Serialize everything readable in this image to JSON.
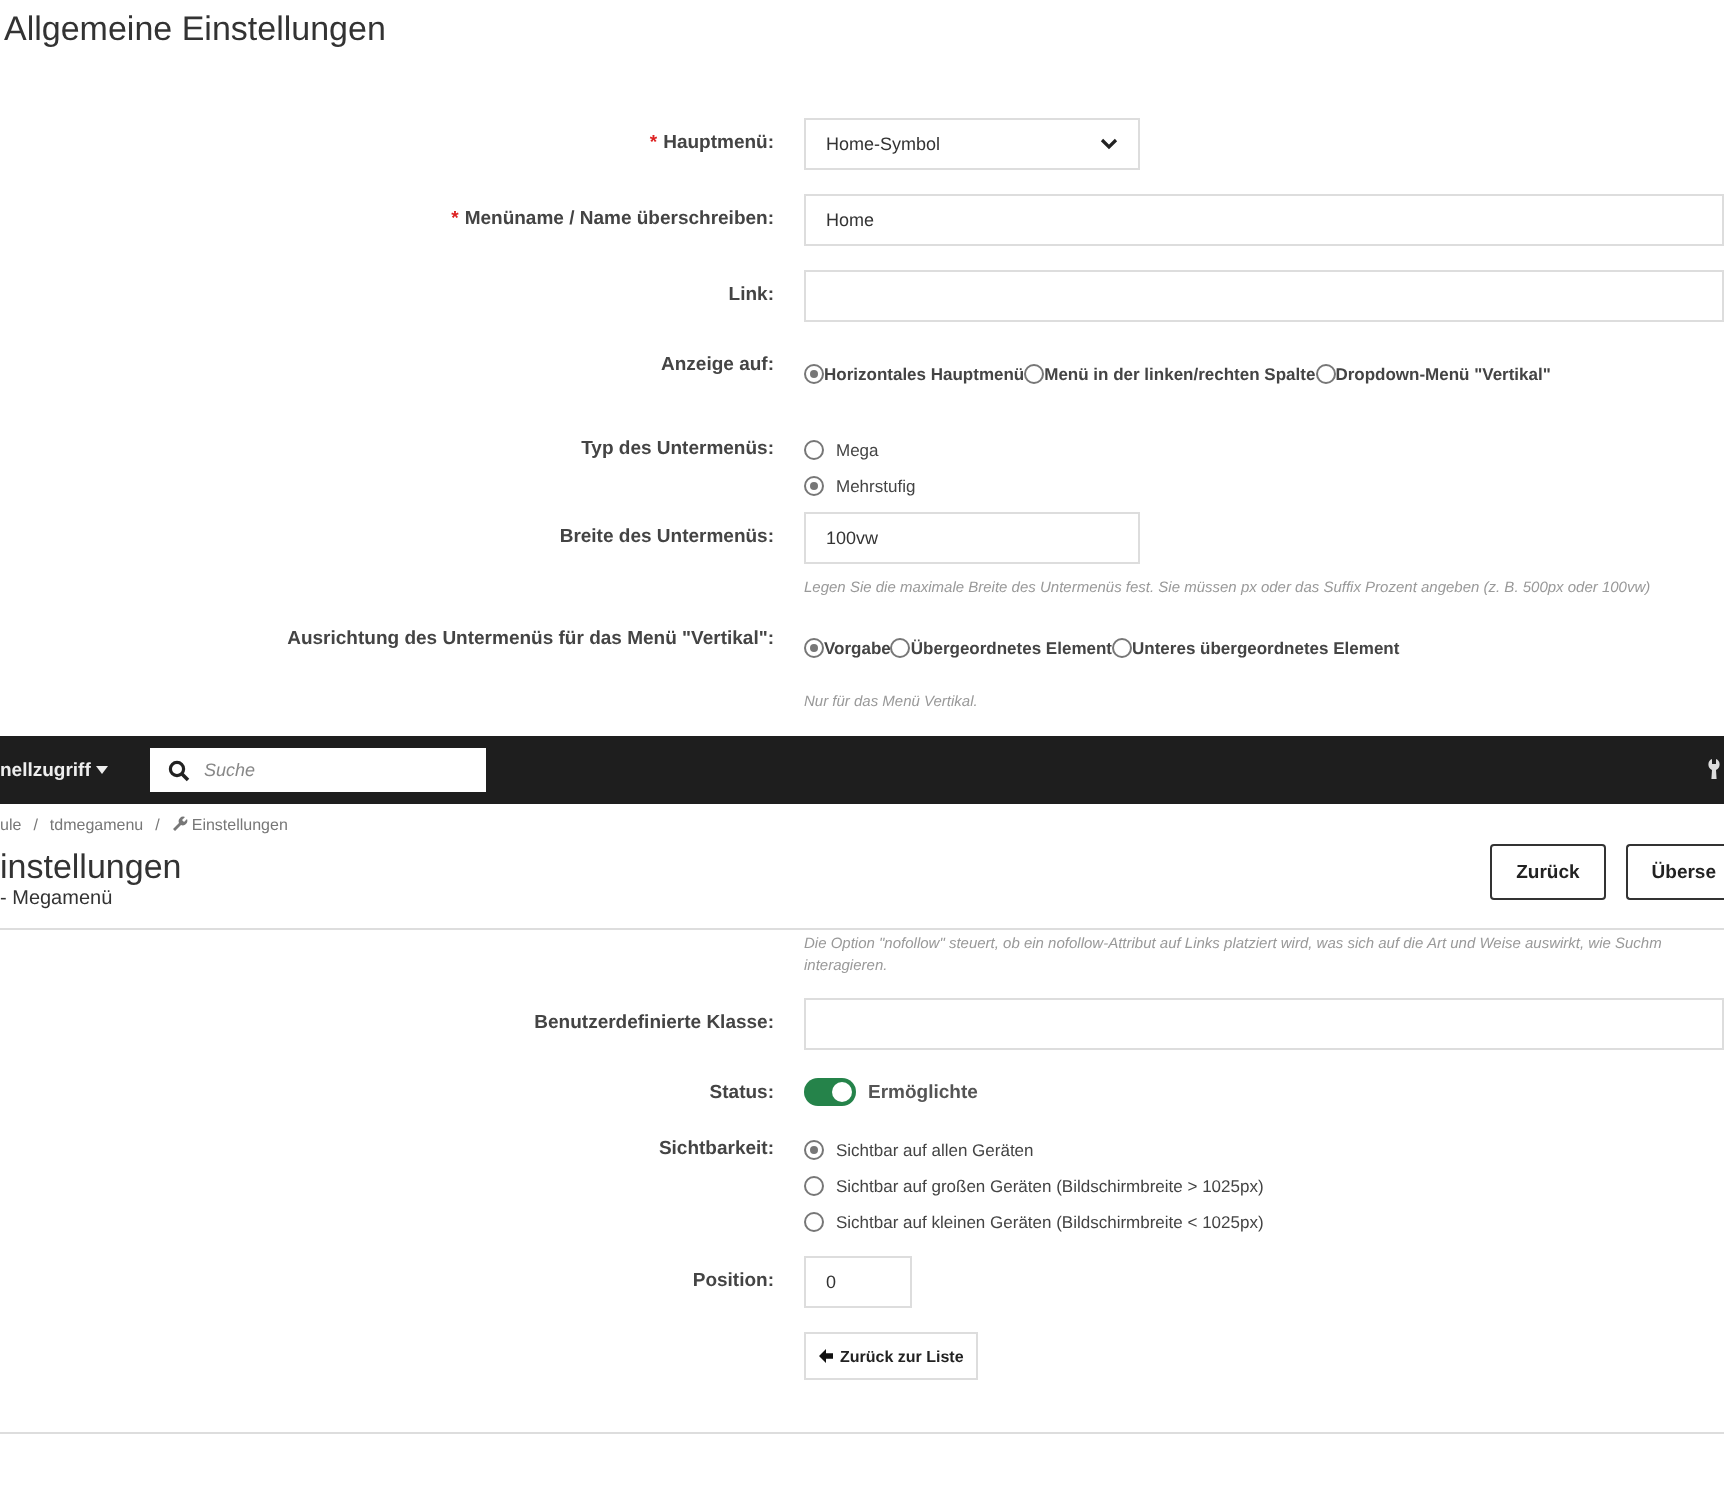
{
  "section_title": "Allgemeine Einstellungen",
  "general_fields": [
    {
      "kind": "select",
      "label": "Hauptmenü:",
      "required": "*",
      "value": "Home-Symbol"
    },
    {
      "kind": "text",
      "label": "Menüname / Name überschreiben:",
      "required": "*",
      "value": "Home",
      "wide": true
    },
    {
      "kind": "text",
      "label": "Link:",
      "wide": true
    },
    {
      "kind": "radio_row",
      "label": "Anzeige auf:",
      "options": [
        {
          "label": "Horizontales Hauptmenü",
          "selected": true
        },
        {
          "label": "Menü in der linken/rechten Spalte",
          "selected": false
        },
        {
          "label": "Dropdown-Menü \"Vertikal\"",
          "selected": false
        }
      ]
    },
    {
      "kind": "radio_list",
      "label": "Typ des Untermenüs:",
      "options": [
        {
          "label": "Mega",
          "selected": false
        },
        {
          "label": "Mehrstufig",
          "selected": true
        }
      ]
    },
    {
      "kind": "text",
      "label": "Breite des Untermenüs:",
      "value": "100vw",
      "wide": false,
      "help": "Legen Sie die maximale Breite des Untermenüs fest. Sie müssen px oder das Suffix Prozent angeben (z. B. 500px oder 100vw)"
    },
    {
      "kind": "radio_row",
      "label": "Ausrichtung des Untermenüs für das Menü \"Vertikal\":",
      "options": [
        {
          "label": "Vorgabe",
          "selected": true
        },
        {
          "label": "Übergeordnetes Element",
          "selected": false
        },
        {
          "label": "Unteres übergeordnetes Element",
          "selected": false
        }
      ],
      "help": "Nur für das Menü Vertikal."
    }
  ],
  "topbar": {
    "menu": "nellzugriff",
    "search": {
      "placeholder": "Suche"
    }
  },
  "breadcrumb": [
    {
      "label": "ule"
    },
    {
      "separator": "/",
      "label": "tdmegamenu"
    },
    {
      "separator": "/",
      "label": "Einstellungen"
    }
  ],
  "header": {
    "title": "instellungen",
    "subtitle": "- Megamenü",
    "buttons": [
      "Zurück",
      "Überse"
    ]
  },
  "nofollow_help": [
    "Die Option \"nofollow\" steuert, ob ein nofollow-Attribut auf Links platziert wird, was sich auf die Art und Weise auswirkt, wie Suchm",
    "interagieren."
  ],
  "fields": [
    {
      "kind": "text",
      "label": "Benutzerdefinierte Klasse:",
      "wide": true
    },
    {
      "kind": "toggle",
      "label": "Status:",
      "on": true,
      "value": "Ermöglichte"
    },
    {
      "kind": "radio_list",
      "label": "Sichtbarkeit:",
      "options": [
        {
          "label": "Sichtbar auf allen Geräten",
          "selected": true
        },
        {
          "label": "Sichtbar auf großen Geräten (Bildschirmbreite > 1025px)",
          "selected": false
        },
        {
          "label": "Sichtbar auf kleinen Geräten (Bildschirmbreite < 1025px)",
          "selected": false
        }
      ]
    },
    {
      "kind": "number",
      "label": "Position:",
      "value": "0"
    }
  ],
  "back_button": "Zurück zur Liste"
}
